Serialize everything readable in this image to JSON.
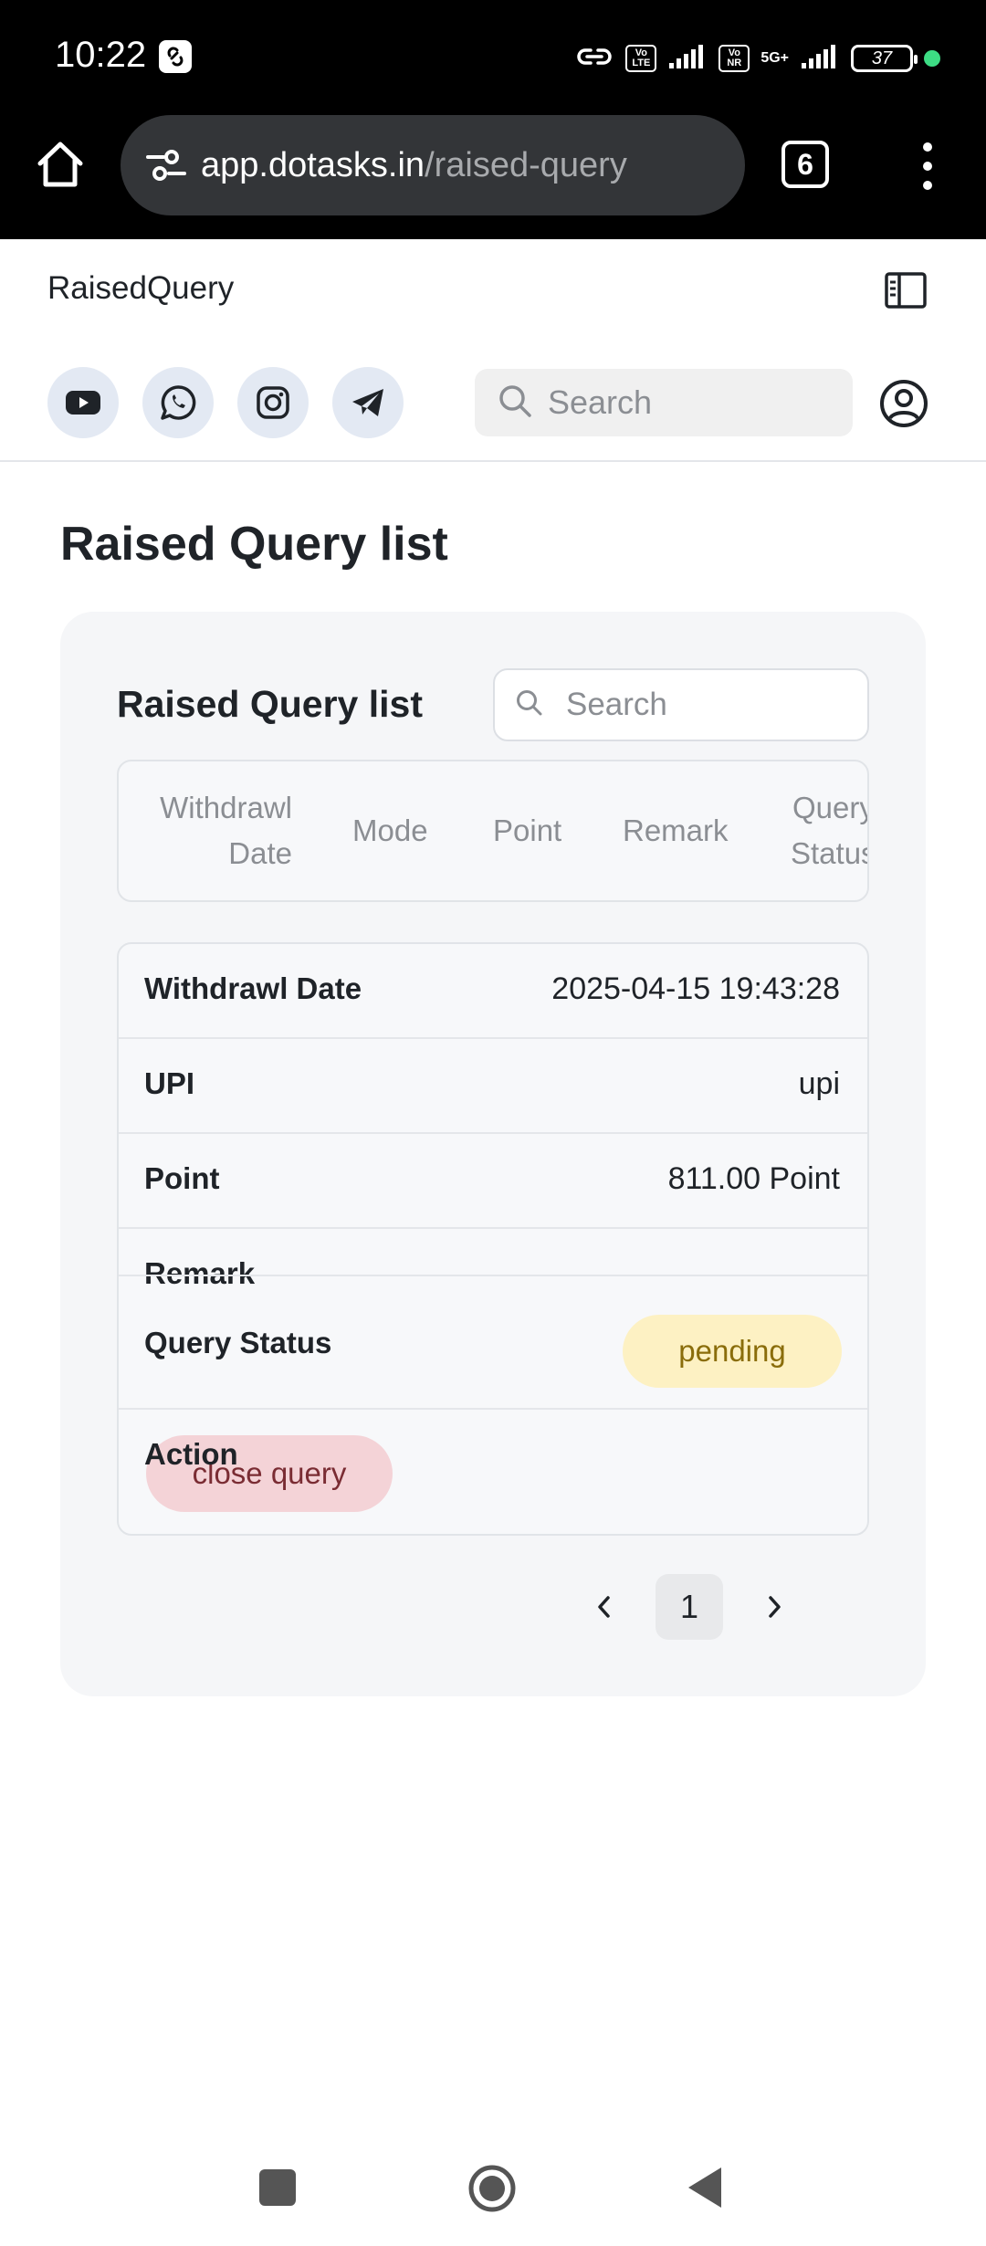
{
  "status_bar": {
    "time": "10:22",
    "battery": "37",
    "network": "5G+",
    "volte1": "Vo LTE",
    "volte2": "Vo NR"
  },
  "browser": {
    "url_host": "app.dotasks.in",
    "url_path": "/raised-query",
    "tab_count": "6"
  },
  "app": {
    "title": "RaisedQuery",
    "social_icons": [
      "youtube-icon",
      "whatsapp-icon",
      "instagram-icon",
      "telegram-icon"
    ],
    "search_placeholder": "Search"
  },
  "page": {
    "title": "Raised Query list"
  },
  "card": {
    "title": "Raised Query list",
    "search_placeholder": "Search",
    "columns": {
      "withdrawl_date_1": "Withdrawl",
      "withdrawl_date_2": "Date",
      "mode": "Mode",
      "point": "Point",
      "remark": "Remark",
      "query_status_1": "Query",
      "query_status_2": "Status"
    },
    "record": {
      "withdrawl_date_label": "Withdrawl Date",
      "withdrawl_date": "2025-04-15 19:43:28",
      "mode_label": "UPI",
      "mode": "upi",
      "point_label": "Point",
      "point": "811.00 Point",
      "remark_label": "Remark",
      "query_status_label": "Query Status",
      "query_status": "pending",
      "action_label": "Action",
      "action_button": "close query"
    }
  },
  "pagination": {
    "current_page": "1"
  },
  "colors": {
    "pending_bg": "#fdf1c3",
    "close_btn_bg": "#f4d3d7",
    "accent_social": "#e3e9f3"
  }
}
